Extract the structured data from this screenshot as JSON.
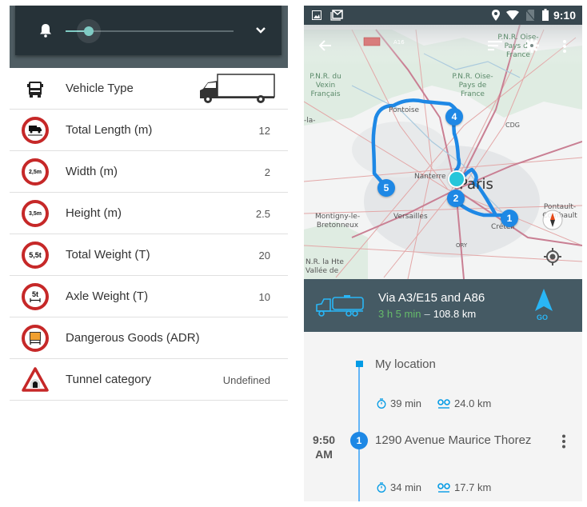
{
  "left_panel": {
    "volume": {
      "icon": "bell-icon",
      "level": 0.14,
      "expand_icon": "chevron-down-icon"
    },
    "settings": [
      {
        "id": "vehicle-type",
        "icon": "truck-front-icon",
        "label": "Vehicle Type",
        "value": "",
        "value_icon": "box-truck-icon"
      },
      {
        "id": "total-length",
        "icon": "length-limit-sign-icon",
        "label": "Total Length (m)",
        "value": "12"
      },
      {
        "id": "width",
        "icon": "width-limit-sign-icon",
        "sign_text": "2,5m",
        "label": "Width (m)",
        "value": "2"
      },
      {
        "id": "height",
        "icon": "height-limit-sign-icon",
        "sign_text": "3,5m",
        "label": "Height (m)",
        "value": "2.5"
      },
      {
        "id": "total-weight",
        "icon": "weight-limit-sign-icon",
        "sign_text": "5,5t",
        "label": "Total Weight (T)",
        "value": "20"
      },
      {
        "id": "axle-weight",
        "icon": "axle-weight-sign-icon",
        "sign_text": "5t",
        "label": "Axle Weight (T)",
        "value": "10"
      },
      {
        "id": "dangerous-goods",
        "icon": "dangerous-goods-sign-icon",
        "label": "Dangerous Goods (ADR)",
        "value": ""
      },
      {
        "id": "tunnel-category",
        "icon": "tunnel-sign-icon",
        "label": "Tunnel category",
        "value": "Undefined"
      }
    ]
  },
  "right_panel": {
    "status_bar": {
      "left_icons": [
        "gallery-icon",
        "gmail-icon"
      ],
      "right_icons": [
        "location-icon",
        "wifi-icon",
        "no-sim-icon",
        "battery-icon"
      ],
      "time": "9:10"
    },
    "toolbar": {
      "back_icon": "arrow-left-icon",
      "sort_icon": "sort-icon",
      "settings_icon": "gear-icon",
      "more_icon": "more-vert-icon"
    },
    "map": {
      "labels": {
        "vexin": "P.N.R. du\nVexin\nFrançais",
        "oise": "P.N.R. Oise-\nPays de\nFrance",
        "oise_top": "P.N.R. Oise-\nPays de\nFrance",
        "road": "A16",
        "pontoise": "Pontoise",
        "la": "-la-",
        "cdg": "CDG",
        "nanterre": "Nanterre",
        "paris": "Paris",
        "versailles": "Versailles",
        "montigny": "Montigny-le-\nBretonneux",
        "creteil": "Créteil",
        "pontault": "Pontault-\nCombault",
        "ory": "ORY",
        "vallee": "N.R. la Hte\nVallée de"
      },
      "waypoints": [
        "1",
        "2",
        "4",
        "5"
      ],
      "compass_icon": "compass-icon",
      "locate_icon": "my-location-icon"
    },
    "route": {
      "vehicle_icon": "tanker-truck-icon",
      "title": "Via A3/E15 and A86",
      "duration": "3 h 5 min",
      "separator": "–",
      "distance": "108.8 km",
      "go_label": "GO",
      "colors": {
        "duration": "#66bb6a",
        "go": "#29b6f6"
      }
    },
    "itinerary": {
      "start": {
        "name": "My location",
        "leg_time": "39 min",
        "leg_distance": "24.0 km"
      },
      "stops": [
        {
          "number": "1",
          "eta": "9:50",
          "eta_period": "AM",
          "name": "1290 Avenue Maurice Thorez",
          "leg_time": "34 min",
          "leg_distance": "17.7 km"
        }
      ]
    }
  }
}
